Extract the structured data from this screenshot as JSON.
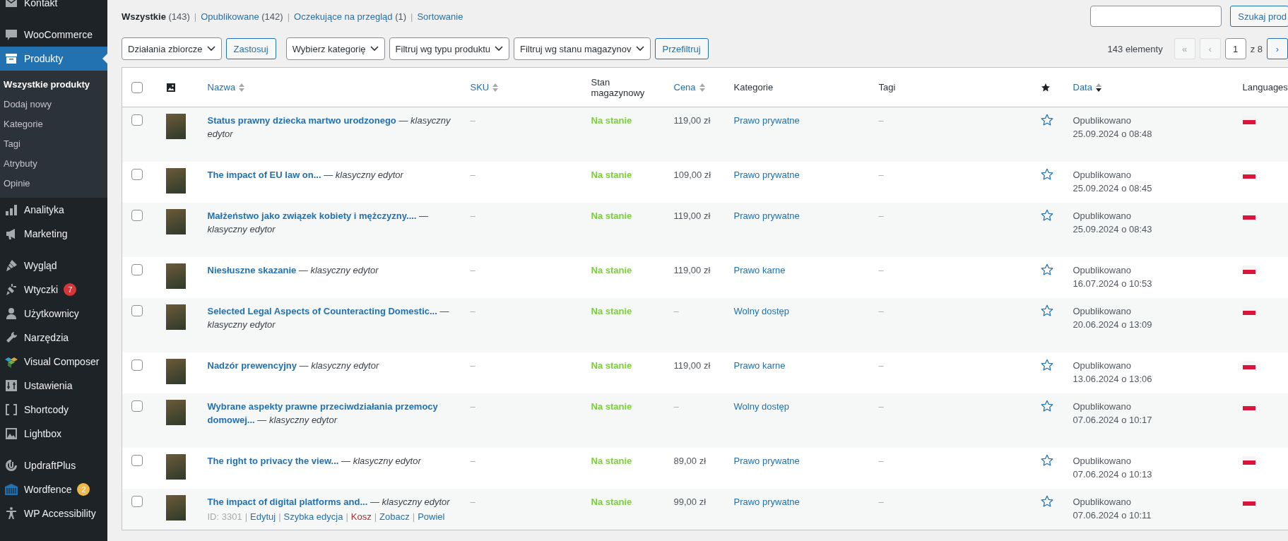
{
  "sidebar": {
    "groups": [
      [
        {
          "label": "Kontakt",
          "selected": false
        }
      ],
      [
        {
          "label": "WooCommerce",
          "selected": false
        },
        {
          "label": "Produkty",
          "selected": true,
          "children": [
            {
              "label": "Wszystkie produkty",
              "selected": true
            },
            {
              "label": "Dodaj nowy",
              "selected": false
            },
            {
              "label": "Kategorie",
              "selected": false
            },
            {
              "label": "Tagi",
              "selected": false
            },
            {
              "label": "Atrybuty",
              "selected": false
            },
            {
              "label": "Opinie",
              "selected": false
            }
          ]
        },
        {
          "label": "Analityka",
          "selected": false
        },
        {
          "label": "Marketing",
          "selected": false
        }
      ],
      [
        {
          "label": "Wygląd",
          "selected": false
        },
        {
          "label": "Wtyczki",
          "selected": false,
          "badge": {
            "text": "7",
            "color": "#d63638"
          }
        },
        {
          "label": "Użytkownicy",
          "selected": false
        },
        {
          "label": "Narzędzia",
          "selected": false
        },
        {
          "label": "Visual Composer",
          "selected": false
        },
        {
          "label": "Ustawienia",
          "selected": false
        },
        {
          "label": "Shortcody",
          "selected": false
        },
        {
          "label": "Lightbox",
          "selected": false
        }
      ],
      [
        {
          "label": "UpdraftPlus",
          "selected": false
        },
        {
          "label": "Wordfence",
          "selected": false,
          "badge": {
            "text": "2",
            "color": "#f0b849"
          }
        },
        {
          "label": "WP Accessibility",
          "selected": false
        }
      ]
    ]
  },
  "views": {
    "separator": "|",
    "items": [
      {
        "label": "Wszystkie",
        "count": "(143)",
        "selected": true
      },
      {
        "label": "Opublikowane",
        "count": "(142)",
        "selected": false
      },
      {
        "label": "Oczekujące na przegląd",
        "count": "(1)",
        "selected": false
      },
      {
        "label": "Sortowanie",
        "selected": false
      }
    ]
  },
  "search": {
    "button": "Szukaj prod"
  },
  "filters": {
    "bulk": "Działania zbiorcze",
    "apply": "Zastosuj",
    "selects": [
      "Wybierz kategorię",
      "Filtruj wg typu produktu",
      "Filtruj wg stanu magazynov"
    ],
    "filter": "Przefiltruj"
  },
  "pagination": {
    "count": "143 elementy",
    "buttons": [
      {
        "label": "«",
        "disabled": true
      },
      {
        "label": "‹",
        "disabled": true
      }
    ],
    "page": "1",
    "of": "z 8",
    "next": {
      "label": "›",
      "disabled": false
    }
  },
  "table": {
    "columns": [
      {
        "kind": "checkbox",
        "checked": false
      },
      {
        "kind": "image"
      },
      {
        "kind": "text",
        "label": "Nazwa",
        "sortable": true,
        "sorted_desc": false
      },
      {
        "kind": "text",
        "label": "SKU",
        "sortable": true,
        "sorted_desc": false
      },
      {
        "kind": "text",
        "label": "Stan magazynowy",
        "sortable": false
      },
      {
        "kind": "text",
        "label": "Cena",
        "sortable": true,
        "sorted_desc": false
      },
      {
        "kind": "text",
        "label": "Kategorie",
        "sortable": false
      },
      {
        "kind": "text",
        "label": "Tagi",
        "sortable": false
      },
      {
        "kind": "star"
      },
      {
        "kind": "text",
        "label": "Data",
        "sortable": true,
        "sorted_desc": true
      },
      {
        "kind": "text",
        "label": "Languages",
        "sortable": false
      }
    ],
    "rows": [
      {
        "checked": false,
        "title": "Status prawny dziecka martwo urodzonego",
        "state": "— *klasyczny edytor*",
        "sku": "–",
        "stock": "Na stanie",
        "price": "119,00 zł",
        "category": "Prawo prywatne",
        "tags": "–",
        "featured": false,
        "status": "Opublikowano",
        "date": "25.09.2024 o 08:48"
      },
      {
        "checked": false,
        "title": "The impact of EU law on...",
        "state": "— *klasyczny edytor*",
        "sku": "–",
        "stock": "Na stanie",
        "price": "109,00 zł",
        "category": "Prawo prywatne",
        "tags": "–",
        "featured": false,
        "status": "Opublikowano",
        "date": "25.09.2024 o 08:45"
      },
      {
        "checked": false,
        "title": "Małżeństwo jako związek kobiety i mężczyzny....",
        "state": "— *klasyczny edytor*",
        "sku": "–",
        "stock": "Na stanie",
        "price": "119,00 zł",
        "category": "Prawo prywatne",
        "tags": "–",
        "featured": false,
        "status": "Opublikowano",
        "date": "25.09.2024 o 08:43"
      },
      {
        "checked": false,
        "title": "Niesłuszne skazanie",
        "state": "— *klasyczny edytor*",
        "sku": "–",
        "stock": "Na stanie",
        "price": "119,00 zł",
        "category": "Prawo karne",
        "tags": "–",
        "featured": false,
        "status": "Opublikowano",
        "date": "16.07.2024 o 10:53"
      },
      {
        "checked": false,
        "title": "Selected Legal Aspects of Counteracting Domestic...",
        "state": "— *klasyczny edytor*",
        "sku": "–",
        "stock": "Na stanie",
        "price": "–",
        "category": "Wolny dostęp",
        "tags": "–",
        "featured": false,
        "status": "Opublikowano",
        "date": "20.06.2024 o 13:09"
      },
      {
        "checked": false,
        "title": "Nadzór prewencyjny",
        "state": "— *klasyczny edytor*",
        "sku": "–",
        "stock": "Na stanie",
        "price": "119,00 zł",
        "category": "Prawo karne",
        "tags": "–",
        "featured": false,
        "status": "Opublikowano",
        "date": "13.06.2024 o 13:06"
      },
      {
        "checked": false,
        "title": "Wybrane aspekty prawne przeciwdziałania przemocy domowej...",
        "state": "— *klasyczny edytor*",
        "sku": "–",
        "stock": "Na stanie",
        "price": "–",
        "category": "Wolny dostęp",
        "tags": "–",
        "featured": false,
        "status": "Opublikowano",
        "date": "07.06.2024 o 10:17"
      },
      {
        "checked": false,
        "title": "The right to privacy the view...",
        "state": "— *klasyczny edytor*",
        "sku": "–",
        "stock": "Na stanie",
        "price": "89,00 zł",
        "category": "Prawo prywatne",
        "tags": "–",
        "featured": false,
        "status": "Opublikowano",
        "date": "07.06.2024 o 10:13"
      },
      {
        "checked": false,
        "title": "The impact of digital platforms and...",
        "state": "— *klasyczny edytor*",
        "sku": "–",
        "stock": "Na stanie",
        "price": "99,00 zł",
        "category": "Prawo prywatne",
        "tags": "–",
        "featured": false,
        "status": "Opublikowano",
        "date": "07.06.2024 o 10:11",
        "actions": {
          "id": "ID: 3301",
          "separator": "|",
          "items": [
            {
              "label": "Edytuj",
              "kind": "link"
            },
            {
              "label": "Szybka edycja",
              "kind": "link"
            },
            {
              "label": "Kosz",
              "kind": "delete"
            },
            {
              "label": "Zobacz",
              "kind": "link"
            },
            {
              "label": "Powiel",
              "kind": "link"
            }
          ]
        }
      }
    ]
  }
}
